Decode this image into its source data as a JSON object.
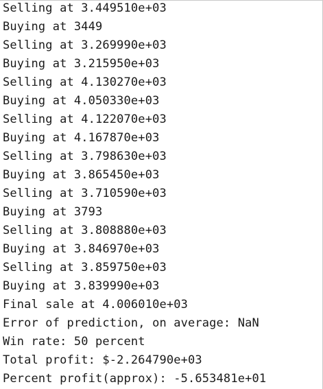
{
  "console": {
    "lines": [
      "Selling at 3.449510e+03",
      "Buying at 3449",
      "Selling at 3.269990e+03",
      "Buying at 3.215950e+03",
      "Selling at 4.130270e+03",
      "Buying at 4.050330e+03",
      "Selling at 4.122070e+03",
      "Buying at 4.167870e+03",
      "Selling at 3.798630e+03",
      "Buying at 3.865450e+03",
      "Selling at 3.710590e+03",
      "Buying at 3793",
      "Selling at 3.808880e+03",
      "Buying at 3.846970e+03",
      "Selling at 3.859750e+03",
      "Buying at 3.839990e+03",
      "Final sale at 4.006010e+03",
      "Error of prediction, on average: NaN",
      "Win rate: 50 percent",
      "Total profit: $-2.264790e+03",
      "Percent profit(approx): -5.653481e+01"
    ]
  }
}
